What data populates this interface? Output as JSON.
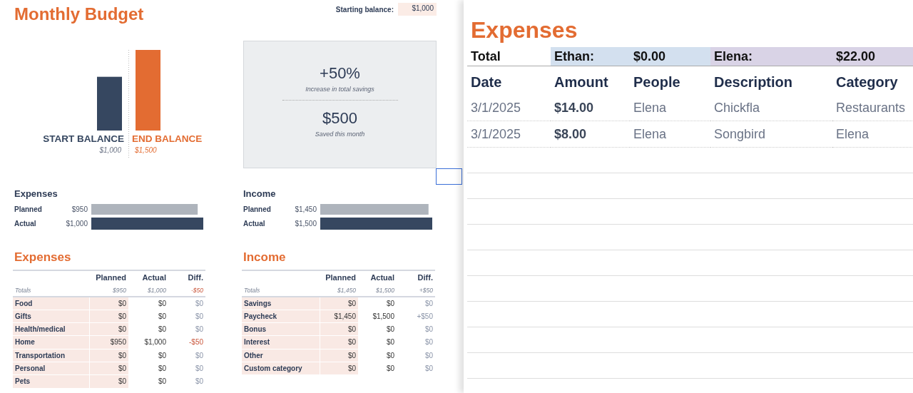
{
  "budget": {
    "title": "Monthly Budget",
    "starting_balance": {
      "label": "Starting balance:",
      "value": "$1,000"
    },
    "balance_chart": {
      "chart_data": {
        "type": "bar",
        "categories": [
          "START BALANCE",
          "END BALANCE"
        ],
        "values": [
          1000,
          1500
        ],
        "value_labels": [
          "$1,000",
          "$1,500"
        ]
      }
    },
    "summary": [
      {
        "value": "+50%",
        "caption": "Increase in total savings"
      },
      {
        "value": "$500",
        "caption": "Saved this month"
      }
    ],
    "comparisons": [
      {
        "title": "Expenses",
        "chart_data": {
          "type": "bar",
          "orientation": "horizontal",
          "categories": [
            "Planned",
            "Actual"
          ],
          "values": [
            950,
            1000
          ],
          "value_labels": [
            "$950",
            "$1,000"
          ]
        }
      },
      {
        "title": "Income",
        "chart_data": {
          "type": "bar",
          "orientation": "horizontal",
          "categories": [
            "Planned",
            "Actual"
          ],
          "values": [
            1450,
            1500
          ],
          "value_labels": [
            "$1,450",
            "$1,500"
          ]
        }
      }
    ],
    "tables": [
      {
        "title": "Expenses",
        "columns": [
          "Planned",
          "Actual",
          "Diff."
        ],
        "totals": {
          "label": "Totals",
          "planned": "$950",
          "actual": "$1,000",
          "diff": "-$50",
          "negative": true
        },
        "rows": [
          {
            "category": "Food",
            "planned": "$0",
            "actual": "$0",
            "diff": "$0",
            "negative": false
          },
          {
            "category": "Gifts",
            "planned": "$0",
            "actual": "$0",
            "diff": "$0",
            "negative": false
          },
          {
            "category": "Health/medical",
            "planned": "$0",
            "actual": "$0",
            "diff": "$0",
            "negative": false
          },
          {
            "category": "Home",
            "planned": "$950",
            "actual": "$1,000",
            "diff": "-$50",
            "negative": true
          },
          {
            "category": "Transportation",
            "planned": "$0",
            "actual": "$0",
            "diff": "$0",
            "negative": false
          },
          {
            "category": "Personal",
            "planned": "$0",
            "actual": "$0",
            "diff": "$0",
            "negative": false
          },
          {
            "category": "Pets",
            "planned": "$0",
            "actual": "$0",
            "diff": "$0",
            "negative": false
          }
        ]
      },
      {
        "title": "Income",
        "columns": [
          "Planned",
          "Actual",
          "Diff."
        ],
        "totals": {
          "label": "Totals",
          "planned": "$1,450",
          "actual": "$1,500",
          "diff": "+$50",
          "negative": false
        },
        "rows": [
          {
            "category": "Savings",
            "planned": "$0",
            "actual": "$0",
            "diff": "$0",
            "negative": false
          },
          {
            "category": "Paycheck",
            "planned": "$1,450",
            "actual": "$1,500",
            "diff": "+$50",
            "negative": false
          },
          {
            "category": "Bonus",
            "planned": "$0",
            "actual": "$0",
            "diff": "$0",
            "negative": false
          },
          {
            "category": "Interest",
            "planned": "$0",
            "actual": "$0",
            "diff": "$0",
            "negative": false
          },
          {
            "category": "Other",
            "planned": "$0",
            "actual": "$0",
            "diff": "$0",
            "negative": false
          },
          {
            "category": "Custom category",
            "planned": "$0",
            "actual": "$0",
            "diff": "$0",
            "negative": false
          }
        ]
      }
    ]
  },
  "expense_log": {
    "title": "Expenses",
    "total_label": "Total",
    "people_totals": [
      {
        "name": "Ethan:",
        "amount": "$0.00",
        "color": "#d3e0ef"
      },
      {
        "name": "Elena:",
        "amount": "$22.00",
        "color": "#d9d3e6"
      }
    ],
    "columns": [
      "Date",
      "Amount",
      "People",
      "Description",
      "Category"
    ],
    "rows": [
      [
        "3/1/2025",
        "$14.00",
        "Elena",
        "Chickfla",
        "Restaurants"
      ],
      [
        "3/1/2025",
        "$8.00",
        "Elena",
        "Songbird",
        "Elena"
      ]
    ]
  }
}
